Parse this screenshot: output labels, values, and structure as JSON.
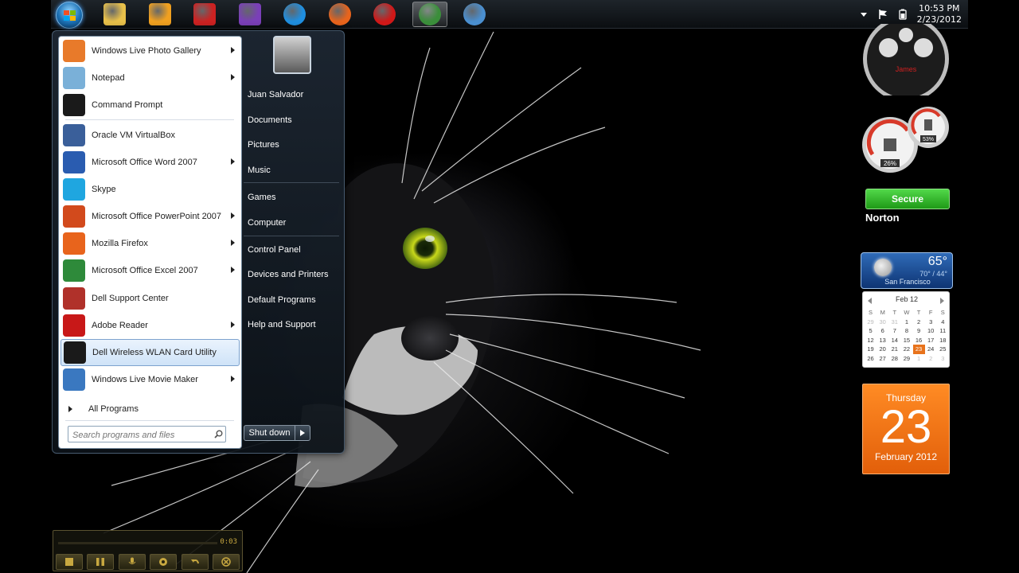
{
  "taskbar": {
    "pinned": [
      {
        "name": "windows-explorer",
        "color": "#e8c04a",
        "active": false
      },
      {
        "name": "media-player",
        "color": "#f0a020",
        "active": false
      },
      {
        "name": "m-app",
        "color": "#cc2222",
        "active": false
      },
      {
        "name": "purple-app",
        "color": "#7a3fb8",
        "active": false
      },
      {
        "name": "internet-explorer",
        "color": "#1f8fe0",
        "active": false
      },
      {
        "name": "firefox",
        "color": "#e8641c",
        "active": false
      },
      {
        "name": "opera",
        "color": "#d01818",
        "active": false
      },
      {
        "name": "chrome",
        "color": "#3a8e3a",
        "active": true
      },
      {
        "name": "safari",
        "color": "#4a8fd0",
        "active": false
      }
    ],
    "clock_time": "10:53 PM",
    "clock_date": "2/23/2012"
  },
  "start_menu": {
    "programs": [
      {
        "label": "Windows Live Photo Gallery",
        "icon": "photo-gallery-icon",
        "color": "#e87a2a",
        "arrow": true
      },
      {
        "label": "Notepad",
        "icon": "notepad-icon",
        "color": "#7ab0d8",
        "arrow": true
      },
      {
        "label": "Command Prompt",
        "icon": "command-prompt-icon",
        "color": "#1a1a1a",
        "arrow": false
      },
      {
        "label": "Oracle VM VirtualBox",
        "icon": "virtualbox-icon",
        "color": "#3a5f9a",
        "arrow": false
      },
      {
        "label": "Microsoft Office Word 2007",
        "icon": "word-icon",
        "color": "#2a5cb0",
        "arrow": true
      },
      {
        "label": "Skype",
        "icon": "skype-icon",
        "color": "#1fa6e0",
        "arrow": false
      },
      {
        "label": "Microsoft Office PowerPoint 2007",
        "icon": "powerpoint-icon",
        "color": "#d24a1c",
        "arrow": true
      },
      {
        "label": "Mozilla Firefox",
        "icon": "firefox-icon",
        "color": "#e8641c",
        "arrow": true
      },
      {
        "label": "Microsoft Office Excel 2007",
        "icon": "excel-icon",
        "color": "#2e8a3a",
        "arrow": true
      },
      {
        "label": "Dell Support Center",
        "icon": "dell-support-icon",
        "color": "#b0312a",
        "arrow": false
      },
      {
        "label": "Adobe Reader",
        "icon": "adobe-reader-icon",
        "color": "#c81818",
        "arrow": true
      },
      {
        "label": "Dell Wireless WLAN Card Utility",
        "icon": "wlan-utility-icon",
        "color": "#1a1a1a",
        "arrow": false
      },
      {
        "label": "Windows Live Movie Maker",
        "icon": "movie-maker-icon",
        "color": "#3a78c0",
        "arrow": true
      }
    ],
    "all_programs": "All Programs",
    "search_placeholder": "Search programs and files",
    "right_links": [
      {
        "label": "Juan Salvador"
      },
      {
        "label": "Documents"
      },
      {
        "label": "Pictures"
      },
      {
        "label": "Music"
      },
      {
        "label": "Games"
      },
      {
        "label": "Computer"
      },
      {
        "label": "Control Panel"
      },
      {
        "label": "Devices and Printers"
      },
      {
        "label": "Default Programs"
      },
      {
        "label": "Help and Support"
      }
    ],
    "shutdown_label": "Shut down"
  },
  "gadgets": {
    "clock_name": "James",
    "meter_cpu": "26%",
    "meter_mem": "53%",
    "norton_status": "Secure",
    "norton_brand": "Norton",
    "weather_temp": "65°",
    "weather_range": "70° / 44°",
    "weather_city": "San Francisco",
    "calendar_month": "Feb 12",
    "calendar_dow": [
      "S",
      "M",
      "T",
      "W",
      "T",
      "F",
      "S"
    ],
    "calendar_days": [
      {
        "d": "29",
        "other": true
      },
      {
        "d": "30",
        "other": true
      },
      {
        "d": "31",
        "other": true
      },
      {
        "d": "1"
      },
      {
        "d": "2"
      },
      {
        "d": "3"
      },
      {
        "d": "4"
      },
      {
        "d": "5"
      },
      {
        "d": "6"
      },
      {
        "d": "7"
      },
      {
        "d": "8"
      },
      {
        "d": "9"
      },
      {
        "d": "10"
      },
      {
        "d": "11"
      },
      {
        "d": "12"
      },
      {
        "d": "13"
      },
      {
        "d": "14"
      },
      {
        "d": "15"
      },
      {
        "d": "16"
      },
      {
        "d": "17"
      },
      {
        "d": "18"
      },
      {
        "d": "19"
      },
      {
        "d": "20"
      },
      {
        "d": "21"
      },
      {
        "d": "22"
      },
      {
        "d": "23",
        "today": true
      },
      {
        "d": "24"
      },
      {
        "d": "25"
      },
      {
        "d": "26"
      },
      {
        "d": "27"
      },
      {
        "d": "28"
      },
      {
        "d": "29"
      },
      {
        "d": "1",
        "other": true
      },
      {
        "d": "2",
        "other": true
      },
      {
        "d": "3",
        "other": true
      }
    ],
    "day_weekday": "Thursday",
    "day_number": "23",
    "day_month_year": "February 2012"
  },
  "recorder": {
    "time": "0:03"
  }
}
